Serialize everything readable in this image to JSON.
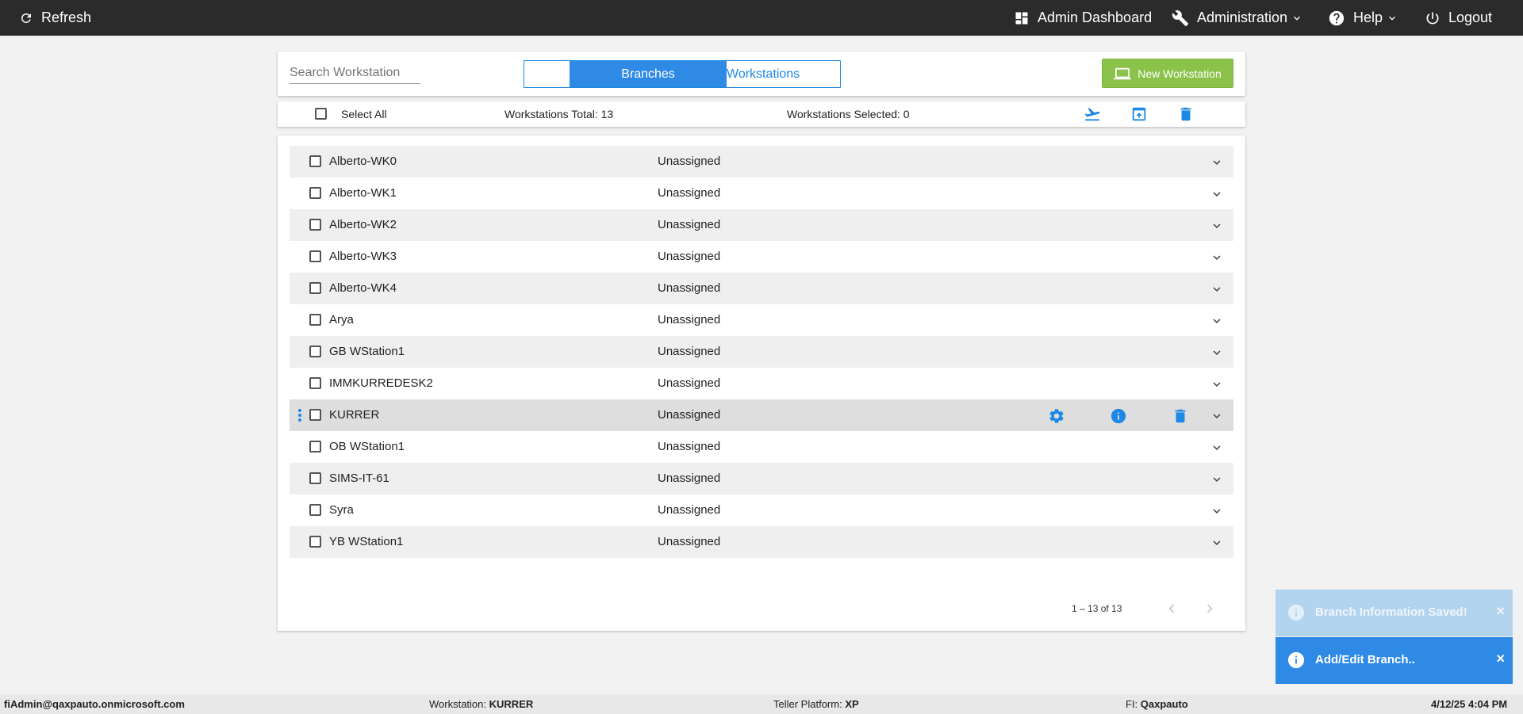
{
  "topbar": {
    "refresh_label": "Refresh",
    "admin_dashboard_label": "Admin Dashboard",
    "administration_label": "Administration",
    "help_label": "Help",
    "logout_label": "Logout"
  },
  "header": {
    "search_placeholder": "Search Workstation",
    "toggle": {
      "branches_label": "Branches",
      "workstations_label": "Workstations",
      "selected": "Branches"
    },
    "new_workstation_label": "New Workstation"
  },
  "toolbar": {
    "select_all_label": "Select All",
    "total_label": "Workstations Total: 13",
    "selected_label": "Workstations Selected: 0",
    "actions": [
      "airplane-icon",
      "upload-icon",
      "trash-icon"
    ]
  },
  "rows": [
    {
      "name": "Alberto-WK0",
      "status": "Unassigned"
    },
    {
      "name": "Alberto-WK1",
      "status": "Unassigned"
    },
    {
      "name": "Alberto-WK2",
      "status": "Unassigned"
    },
    {
      "name": "Alberto-WK3",
      "status": "Unassigned"
    },
    {
      "name": "Alberto-WK4",
      "status": "Unassigned"
    },
    {
      "name": "Arya",
      "status": "Unassigned"
    },
    {
      "name": "GB WStation1",
      "status": "Unassigned"
    },
    {
      "name": "IMMKURREDESK2",
      "status": "Unassigned"
    },
    {
      "name": "KURRER",
      "status": "Unassigned",
      "hovered": true
    },
    {
      "name": "OB WStation1",
      "status": "Unassigned"
    },
    {
      "name": "SIMS-IT-61",
      "status": "Unassigned"
    },
    {
      "name": "Syra",
      "status": "Unassigned"
    },
    {
      "name": "YB WStation1",
      "status": "Unassigned"
    }
  ],
  "pagination": {
    "range_label": "1 – 13 of 13"
  },
  "toasts": [
    {
      "message": "Branch Information Saved!",
      "close": "×",
      "state": "fading"
    },
    {
      "message": "Add/Edit Branch..",
      "close": "×",
      "state": "active"
    }
  ],
  "statusbar": {
    "user": "fiAdmin@qaxpauto.onmicrosoft.com",
    "workstation_label": "Workstation:",
    "workstation_value": "KURRER",
    "platform_label": "Teller Platform:",
    "platform_value": "XP",
    "fi_label": "FI:",
    "fi_value": "Qaxpauto",
    "datetime": "4/12/25 4:04 PM"
  },
  "colors": {
    "topbar_bg": "#2b2b2b",
    "accent_blue": "#2f8ae6",
    "new_button_green": "#8bc34a",
    "row_alt": "#efefef",
    "row_hover": "#dedede"
  }
}
